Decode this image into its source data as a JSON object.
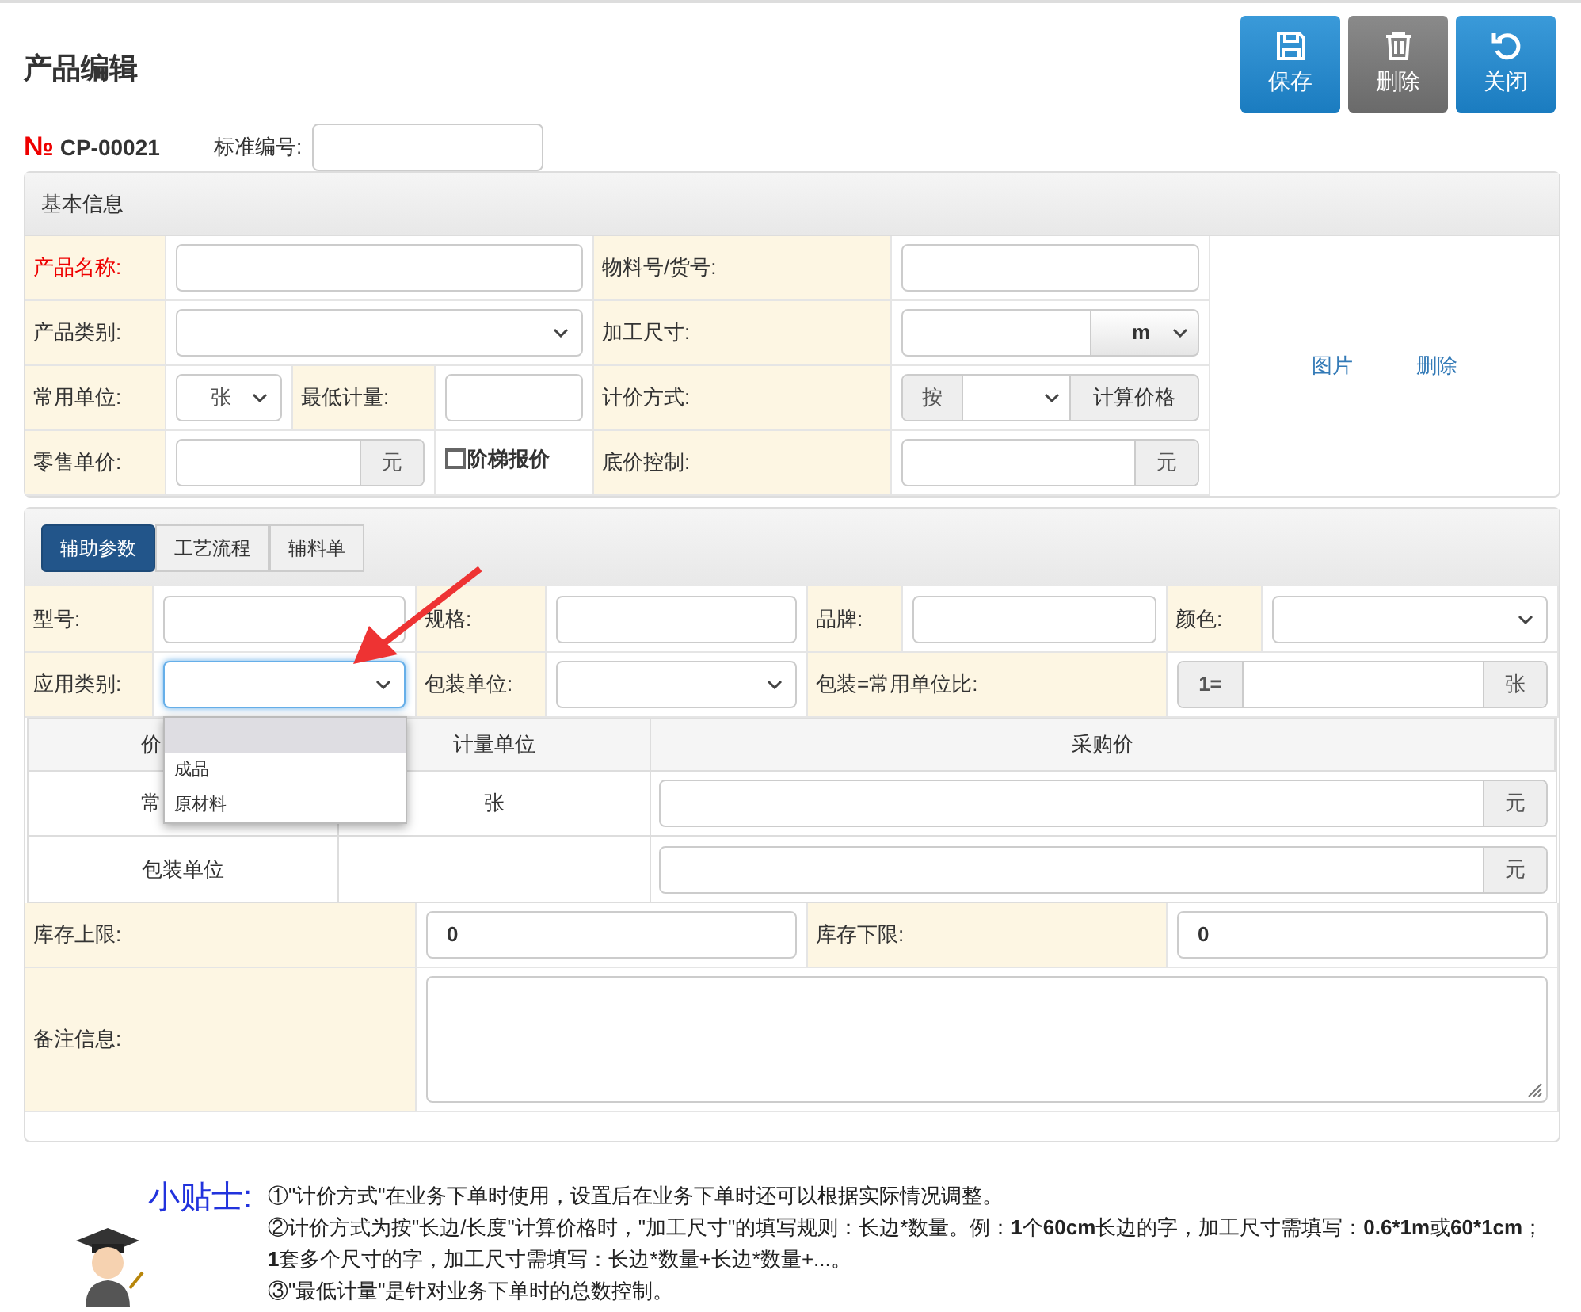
{
  "page_title": "产品编辑",
  "toolbar": [
    {
      "label": "保存",
      "kind": "save"
    },
    {
      "label": "删除",
      "kind": "delete"
    },
    {
      "label": "关闭",
      "kind": "close"
    }
  ],
  "number": {
    "mark": "№",
    "code": "CP-00021"
  },
  "standard_no": {
    "label": "标准编号:"
  },
  "basic": {
    "title": "基本信息",
    "product_name": {
      "label": "产品名称:",
      "required": true
    },
    "material_no": {
      "label": "物料号/货号:"
    },
    "category": {
      "label": "产品类别:"
    },
    "size": {
      "label": "加工尺寸:",
      "unit": "m"
    },
    "unit": {
      "label": "常用单位:",
      "value": "张"
    },
    "min_qty": {
      "label": "最低计量:"
    },
    "pricing": {
      "label": "计价方式:",
      "prefix": "按",
      "button": "计算价格"
    },
    "retail": {
      "label": "零售单价:",
      "suffix": "元"
    },
    "tiered": {
      "label": "阶梯报价",
      "checked": false
    },
    "floor": {
      "label": "底价控制:",
      "suffix": "元"
    },
    "image_links": [
      "图片",
      "删除"
    ]
  },
  "aux": {
    "tabs": [
      {
        "label": "辅助参数",
        "selected": true
      },
      {
        "label": "工艺流程",
        "selected": false
      },
      {
        "label": "辅料单",
        "selected": false
      }
    ],
    "model": {
      "label": "型号:"
    },
    "spec": {
      "label": "规格:"
    },
    "brand": {
      "label": "品牌:"
    },
    "color": {
      "label": "颜色:"
    },
    "usage": {
      "label": "应用类别:",
      "open": true,
      "blank_highlighted": true,
      "options": [
        {
          "label": "成品",
          "selected": false
        },
        {
          "label": "原材料",
          "selected": false
        }
      ]
    },
    "pack_unit": {
      "label": "包装单位:"
    },
    "ratio": {
      "label": "包装=常用单位比:",
      "prefix": "1=",
      "suffix": "张"
    },
    "price_table": {
      "columns": [
        "价",
        "计量单位",
        "采购价"
      ],
      "rows": [
        {
          "name": "常",
          "unit": "张",
          "suffix": "元"
        },
        {
          "name": "包装单位",
          "suffix": "元"
        }
      ]
    },
    "stock_max": {
      "label": "库存上限:",
      "value": "0"
    },
    "stock_min": {
      "label": "库存下限:",
      "value": "0"
    },
    "remarks": {
      "label": "备注信息:"
    }
  },
  "tips": {
    "title": "小贴士:",
    "lines": [
      [
        {
          "text": "①\"计价方式\"在业务下单时使用，设置后在业务下单时还可以根据实际情况调整。",
          "bold": false
        }
      ],
      [
        {
          "text": "②计价方式为按\"长边/长度\"计算价格时，\"加工尺寸\"的填写规则：长边*数量。例：",
          "bold": false
        },
        {
          "text": "1",
          "bold": true
        },
        {
          "text": "个",
          "bold": false
        },
        {
          "text": "60cm",
          "bold": true
        },
        {
          "text": "长边的字，加工尺寸需填写：",
          "bold": false
        },
        {
          "text": "0.6*1m",
          "bold": true
        },
        {
          "text": "或",
          "bold": false
        },
        {
          "text": "60*1cm",
          "bold": true
        },
        {
          "text": "；",
          "bold": false
        },
        {
          "text": "1",
          "bold": true
        },
        {
          "text": "套多个尺寸的字，加工尺寸需填写：长边*数量+长边*数量+...。",
          "bold": false
        }
      ],
      [
        {
          "text": "③\"最低计量\"是针对业务下单时的总数控制。",
          "bold": false
        }
      ]
    ]
  }
}
